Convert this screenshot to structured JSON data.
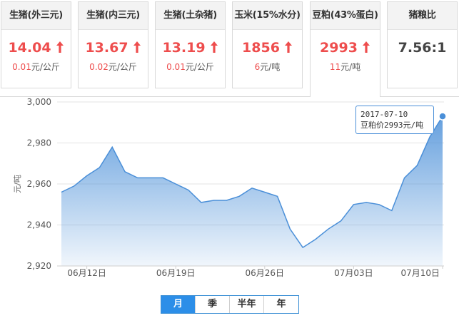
{
  "cards": [
    {
      "name": "生猪(外三元)",
      "price": "14.04",
      "trend": "up",
      "change": "0.01",
      "unit": "元/公斤"
    },
    {
      "name": "生猪(内三元)",
      "price": "13.67",
      "trend": "up",
      "change": "0.02",
      "unit": "元/公斤"
    },
    {
      "name": "生猪(土杂猪)",
      "price": "13.19",
      "trend": "up",
      "change": "0.01",
      "unit": "元/公斤"
    },
    {
      "name": "玉米(15%水分)",
      "price": "1856",
      "trend": "up",
      "change": "6",
      "unit": "元/吨"
    },
    {
      "name": "豆粕(43%蛋白)",
      "price": "2993",
      "trend": "up",
      "change": "11",
      "unit": "元/吨"
    },
    {
      "name": "猪粮比",
      "price": "7.56:1"
    }
  ],
  "colors": {
    "accent": "#2c8ee8",
    "up": "#ee4d4d",
    "line": "#4a8fd8"
  },
  "tooltip": {
    "date": "2017-07-10",
    "text": "豆粕价2993元/吨"
  },
  "range_tabs": [
    "月",
    "季",
    "半年",
    "年"
  ],
  "range_selected": "月",
  "chart_data": {
    "type": "area",
    "title": "",
    "xlabel": "",
    "ylabel": "元/吨",
    "ylim": [
      2920,
      3000
    ],
    "yticks": [
      "3,000",
      "2,980",
      "2,960",
      "2,940",
      "2,920"
    ],
    "ytick_values": [
      3000,
      2980,
      2960,
      2940,
      2920
    ],
    "xtick_labels": [
      "06月12日",
      "06月19日",
      "06月26日",
      "07月03日",
      "07月10日"
    ],
    "xtick_index": [
      4,
      11,
      18,
      25,
      32
    ],
    "grid": true,
    "series": [
      {
        "values": [
          2956,
          2959,
          2964,
          2968,
          2978,
          2966,
          2963,
          2963,
          2963,
          2960,
          2957,
          2951,
          2952,
          2952,
          2954,
          2958,
          2956,
          2954,
          2938,
          2929,
          2933,
          2938,
          2942,
          2950,
          2951,
          2950,
          2947,
          2963,
          2969,
          2983,
          2993
        ]
      }
    ]
  }
}
